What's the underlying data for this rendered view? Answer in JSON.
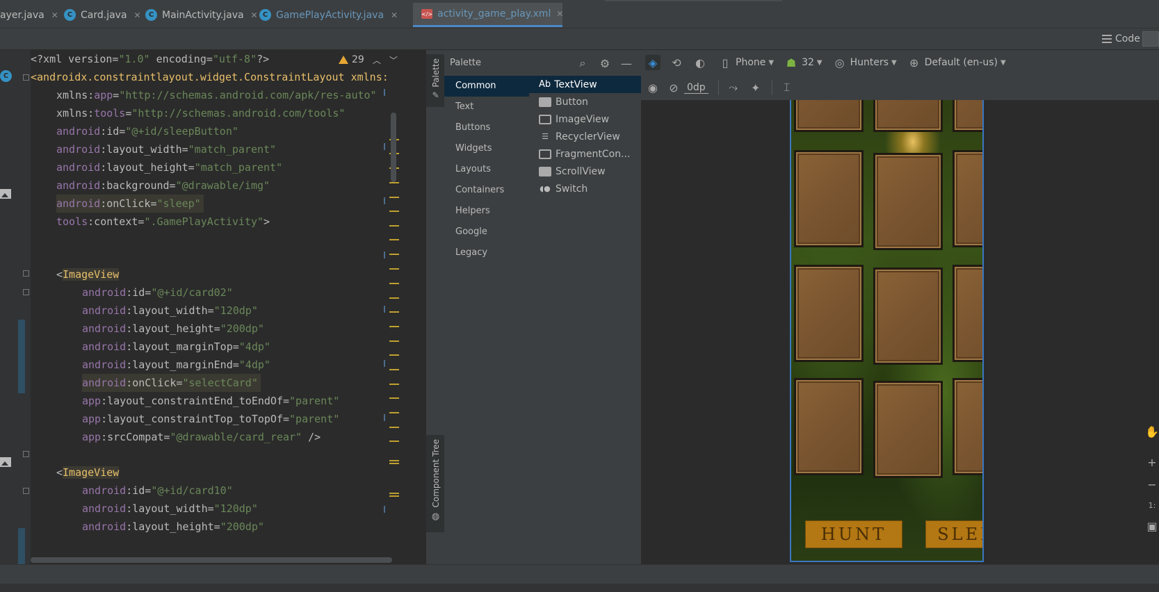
{
  "tabs": [
    {
      "label": "ayer.java",
      "kind": "plain"
    },
    {
      "label": "Card.java",
      "kind": "class"
    },
    {
      "label": "MainActivity.java",
      "kind": "class"
    },
    {
      "label": "GamePlayActivity.java",
      "kind": "class",
      "modified": true
    },
    {
      "label": "activity_game_play.xml",
      "kind": "xml",
      "active": true
    }
  ],
  "view_bar": {
    "code_label": "Code"
  },
  "editor": {
    "warning_count": "29",
    "lines": [
      [
        "<?xml version=",
        "\"1.0\"",
        " encoding=",
        "\"utf-8\"",
        "?>"
      ],
      [
        "<androidx.constraintlayout.widget.ConstraintLayout xmlns:"
      ],
      [
        "xmlns:",
        "app",
        "=",
        "\"http://schemas.android.com/apk/res-auto\""
      ],
      [
        "xmlns:",
        "tools",
        "=",
        "\"http://schemas.android.com/tools\""
      ],
      [
        "android",
        ":id=",
        "\"@+id/sleepButton\""
      ],
      [
        "android",
        ":layout_width=",
        "\"match_parent\""
      ],
      [
        "android",
        ":layout_height=",
        "\"match_parent\""
      ],
      [
        "android",
        ":background=",
        "\"@drawable/img\""
      ],
      [
        "android",
        ":onClick=",
        "\"sleep\""
      ],
      [
        "tools",
        ":context=",
        "\".GamePlayActivity\"",
        ">"
      ],
      [
        "<",
        "ImageView"
      ],
      [
        "android",
        ":id=",
        "\"@+id/card02\""
      ],
      [
        "android",
        ":layout_width=",
        "\"120dp\""
      ],
      [
        "android",
        ":layout_height=",
        "\"200dp\""
      ],
      [
        "android",
        ":layout_marginTop=",
        "\"4dp\""
      ],
      [
        "android",
        ":layout_marginEnd=",
        "\"4dp\""
      ],
      [
        "android",
        ":onClick=",
        "\"selectCard\""
      ],
      [
        "app",
        ":layout_constraintEnd_toEndOf=",
        "\"parent\""
      ],
      [
        "app",
        ":layout_constraintTop_toTopOf=",
        "\"parent\""
      ],
      [
        "app",
        ":srcCompat=",
        "\"@drawable/card_rear\"",
        " />"
      ],
      [
        "<",
        "ImageView"
      ],
      [
        "android",
        ":id=",
        "\"@+id/card10\""
      ],
      [
        "android",
        ":layout_width=",
        "\"120dp\""
      ],
      [
        "android",
        ":layout_height=",
        "\"200dp\""
      ]
    ]
  },
  "side_strips": {
    "palette_tab": "Palette",
    "component_tree_tab": "Component Tree"
  },
  "palette": {
    "title": "Palette",
    "categories": [
      "Common",
      "Text",
      "Buttons",
      "Widgets",
      "Layouts",
      "Containers",
      "Helpers",
      "Google",
      "Legacy"
    ],
    "selected_category": "Common",
    "items": [
      {
        "label": "TextView",
        "icon": "text-icon",
        "prefix": "Ab"
      },
      {
        "label": "Button",
        "icon": "button-icon"
      },
      {
        "label": "ImageView",
        "icon": "image-icon"
      },
      {
        "label": "RecyclerView",
        "icon": "list-icon"
      },
      {
        "label": "FragmentCon...",
        "icon": "fragment-icon"
      },
      {
        "label": "ScrollView",
        "icon": "scroll-icon"
      },
      {
        "label": "Switch",
        "icon": "switch-icon"
      }
    ]
  },
  "design_toolbar": {
    "device": "Phone",
    "api_level": "32",
    "theme": "Hunters",
    "locale": "Default (en-us)",
    "margin_value": "0dp"
  },
  "game": {
    "hunt_label": "HUNT",
    "sleep_label": "SLEEP",
    "colors": {
      "card": "#7a5530",
      "button": "#b37713",
      "selection": "#3a77c2"
    }
  }
}
